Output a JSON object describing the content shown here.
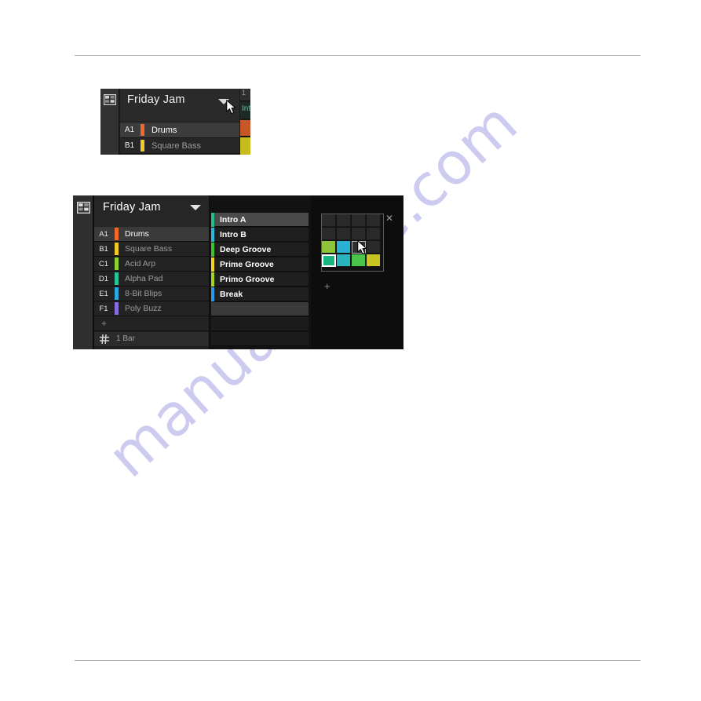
{
  "page": {
    "watermark": "manualshive.com",
    "watermark_color": "#cdcbf0",
    "rule_color": "#aaaaaa"
  },
  "figure_1": {
    "name": "maschine-arranger-crop",
    "grid_icon": "grid-layout-icon",
    "title": "Friday Jam",
    "dropdown_icon": "chevron-down-icon",
    "cursor_icon": "mouse-pointer-icon",
    "tracks": [
      {
        "pad": "A1",
        "name": "Drums",
        "color": "#f2682a",
        "selected": true
      },
      {
        "pad": "B1",
        "name": "Square Bass",
        "color": "#f2c829",
        "selected": false
      }
    ],
    "right_strip": {
      "scene_number": "1",
      "scene_label": "Int",
      "clip_colors": [
        "#c65828",
        "#c7bc1e"
      ]
    }
  },
  "figure_2": {
    "name": "maschine-arranger-scene-color-picker",
    "grid_icon": "grid-layout-icon",
    "title": "Friday Jam",
    "dropdown_icon": "chevron-down-icon",
    "cursor_icon": "mouse-pointer-icon",
    "close_icon": "close-icon",
    "close_label": "✕",
    "add_scene_label": "+",
    "add_track_label": "+",
    "length_icon": "grid-hash-icon",
    "length_value": "1 Bar",
    "tracks": [
      {
        "pad": "A1",
        "name": "Drums",
        "color": "#f2682a",
        "selected": true
      },
      {
        "pad": "B1",
        "name": "Square Bass",
        "color": "#f2c829",
        "selected": false
      },
      {
        "pad": "C1",
        "name": "Acid Arp",
        "color": "#8ed430",
        "selected": false
      },
      {
        "pad": "D1",
        "name": "Alpha Pad",
        "color": "#2bc49a",
        "selected": false
      },
      {
        "pad": "E1",
        "name": "8-Bit Blips",
        "color": "#2ba6e0",
        "selected": false
      },
      {
        "pad": "F1",
        "name": "Poly Buzz",
        "color": "#8a6be0",
        "selected": false
      }
    ],
    "scenes": [
      {
        "label": "Intro A",
        "color": "#1fc08a",
        "selected": true
      },
      {
        "label": "Intro B",
        "color": "#2bb8e0",
        "selected": false
      },
      {
        "label": "Deep Groove",
        "color": "#3cc22e",
        "selected": false
      },
      {
        "label": "Prime Groove",
        "color": "#f0d81e",
        "selected": false
      },
      {
        "label": "Primo Groove",
        "color": "#a8d420",
        "selected": false
      },
      {
        "label": "Break",
        "color": "#2b9ae0",
        "selected": false
      }
    ],
    "empty_scene_slots": 4,
    "color_picker": {
      "name": "scene-color-picker",
      "columns": 4,
      "rows": 4,
      "swatches": [
        [
          "#2a2a2a",
          "#2a2a2a",
          "#2a2a2a",
          "#2a2a2a"
        ],
        [
          "#2a2a2a",
          "#2a2a2a",
          "#2a2a2a",
          "#2a2a2a"
        ],
        [
          "#8ec43a",
          "#2bb0d4",
          "#2a2a2a",
          "#2a2a2a"
        ],
        [
          "#19b57e",
          "#2ab5bc",
          "#4cc44c",
          "#c8c422"
        ]
      ],
      "hovered_cell": {
        "row": 2,
        "col": 2
      },
      "selected_cell": {
        "row": 3,
        "col": 0
      }
    }
  }
}
